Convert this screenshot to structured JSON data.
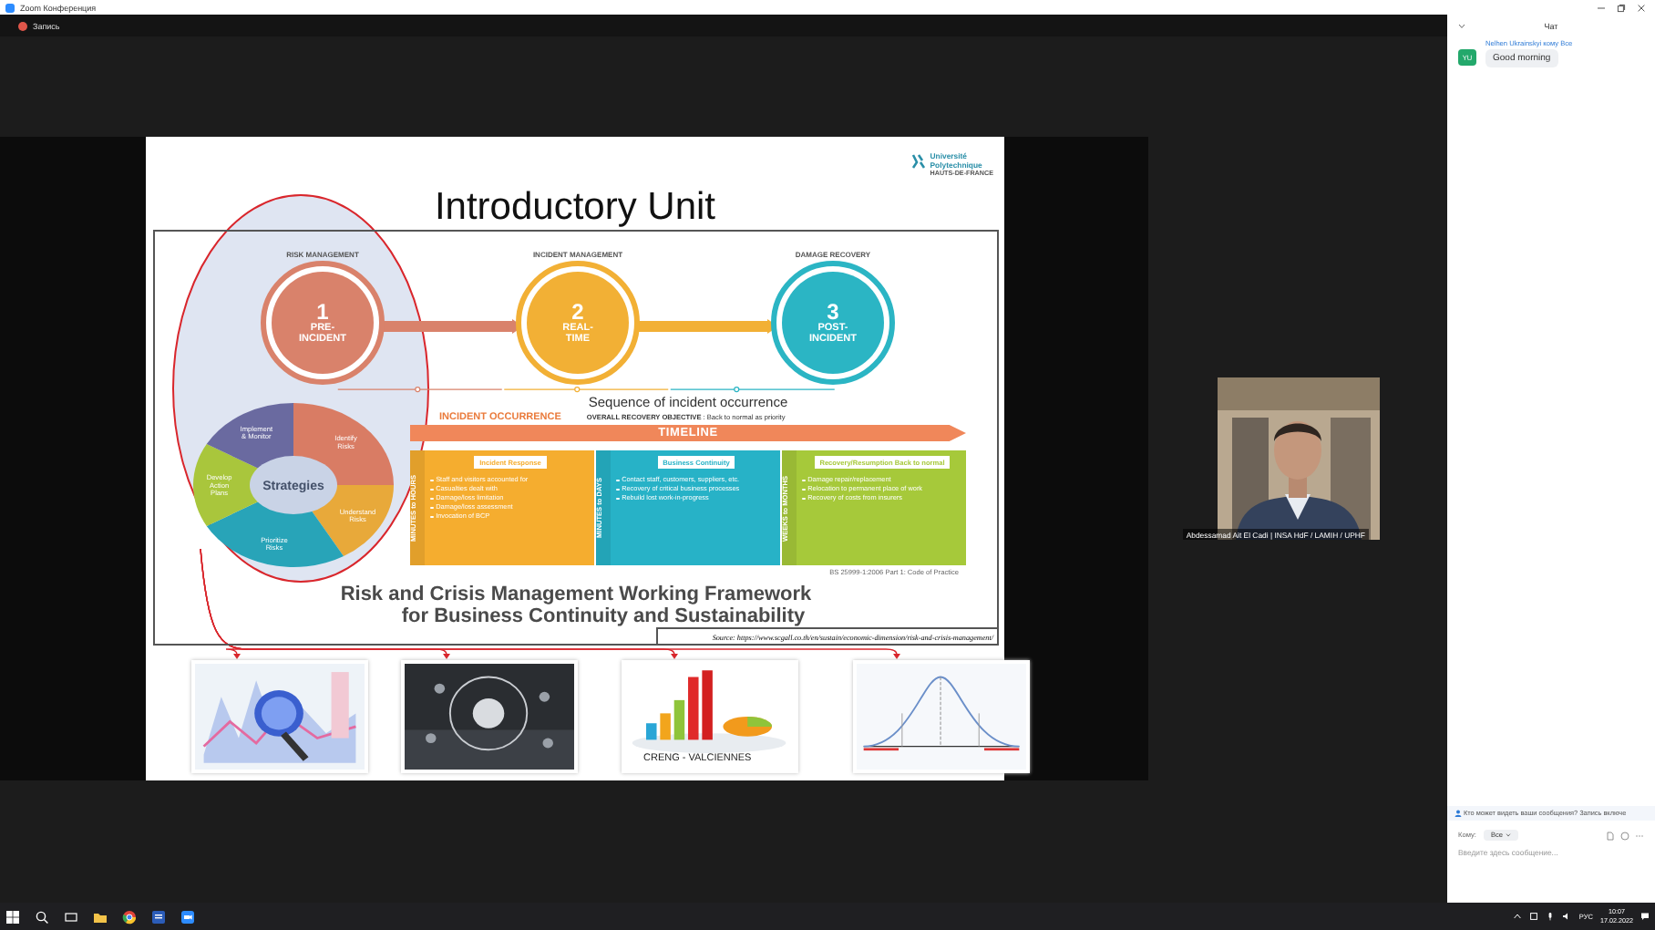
{
  "window": {
    "title": "Zoom Конференция"
  },
  "recording": {
    "label": "Запись"
  },
  "slide": {
    "title": "Introductory Unit",
    "logo": {
      "lines": [
        "Université",
        "Polytechnique",
        "HAUTS-DE-FRANCE"
      ]
    },
    "stages": [
      {
        "heading": "RISK MANAGEMENT",
        "number": "1",
        "label": "PRE-INCIDENT",
        "color": "#d9826b"
      },
      {
        "heading": "INCIDENT MANAGEMENT",
        "number": "2",
        "label": "REAL-TIME",
        "color": "#f2b035"
      },
      {
        "heading": "DAMAGE RECOVERY",
        "number": "3",
        "label": "POST-INCIDENT",
        "color": "#2bb5c4"
      }
    ],
    "sequence_label": "Sequence of incident occurrence",
    "incident_occurrence": "INCIDENT OCCURRENCE",
    "objective": {
      "label": "OVERALL RECOVERY OBJECTIVE",
      "text": ": Back to normal as priority"
    },
    "timeline": "TIMELINE",
    "cycle": {
      "center": "Strategies",
      "segments": [
        {
          "label": "Identify Risks",
          "color": "#d97c64"
        },
        {
          "label": "Understand Risks",
          "color": "#e8a93a"
        },
        {
          "label": "Prioritize Risks",
          "color": "#28a4b8"
        },
        {
          "label": "Develop Action Plans",
          "color": "#a9c63c"
        },
        {
          "label": "Implement & Monitor",
          "color": "#6a6aa0"
        }
      ]
    },
    "phases": [
      {
        "title": "Incident Response",
        "duration": "MINUTES to HOURS",
        "color": "#f5ad2f",
        "bullets": [
          "Staff and visitors accounted for",
          "Casualties dealt with",
          "Damage/loss limitation",
          "Damage/loss assessment",
          "Invocation of BCP"
        ]
      },
      {
        "title": "Business Continuity",
        "duration": "MINUTES to DAYS",
        "color": "#27b2c7",
        "bullets": [
          "Contact staff, customers, suppliers, etc.",
          "Recovery of critical business processes",
          "Rebuild lost work-in-progress"
        ]
      },
      {
        "title": "Recovery/Resumption Back to normal",
        "duration": "WEEKS to MONTHS",
        "color": "#a6c93a",
        "bullets": [
          "Damage repair/replacement",
          "Relocation to permanent place of work",
          "Recovery of costs from insurers"
        ]
      }
    ],
    "standard": "BS 25999-1:2006 Part 1: Code of Practice",
    "framework_title": [
      "Risk and Crisis Management Working Framework",
      "for Business Continuity and Sustainability"
    ],
    "source": "Source: https://www.scgall.co.th/en/sustain/economic-dimension/risk-and-crisis-management/",
    "images": [
      {
        "kind": "picture"
      },
      {
        "kind": "picture"
      },
      {
        "kind": "picture",
        "caption": "CRENG - VALCIENNES"
      },
      {
        "kind": "picture"
      }
    ]
  },
  "participant": {
    "name": "Abdessamad Ait El Cadi | INSA HdF / LAMIH / UPHF"
  },
  "chat": {
    "title": "Чат",
    "messages": [
      {
        "sender": "Nelhen Ukrainskyi кому Все",
        "initials": "YU",
        "text": "Good morning"
      }
    ],
    "notice": "Кто может видеть ваши сообщения? Запись включе",
    "recipient_label": "Кому:",
    "recipient": "Все",
    "placeholder": "Введите здесь сообщение..."
  },
  "taskbar": {
    "language": "РУС",
    "time": "10:07",
    "date": "17.02.2022"
  }
}
